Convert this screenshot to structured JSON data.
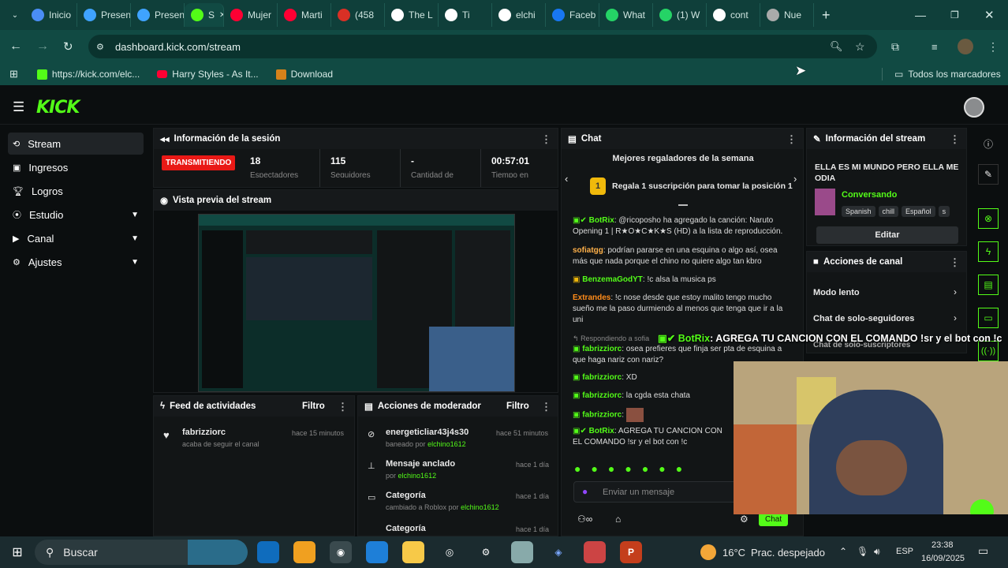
{
  "browser": {
    "tabs": [
      {
        "label": "Inicio",
        "icon": "chrome-icon",
        "color": "#4a8df5"
      },
      {
        "label": "Presen",
        "icon": "slides-icon",
        "color": "#3fa3ff"
      },
      {
        "label": "Presen",
        "icon": "slides-icon",
        "color": "#3fa3ff"
      },
      {
        "label": "S",
        "icon": "kick-icon",
        "color": "#53fc18"
      },
      {
        "label": "Mujer",
        "icon": "youtube-icon",
        "color": "#ff0033"
      },
      {
        "label": "Marti",
        "icon": "youtube-icon",
        "color": "#ff0033"
      },
      {
        "label": "(458",
        "icon": "mail-icon",
        "color": "#d93025"
      },
      {
        "label": "The L",
        "icon": "tiktok-icon",
        "color": "#ffffff"
      },
      {
        "label": "Ti",
        "icon": "tiktok-icon",
        "color": "#ffffff"
      },
      {
        "label": "elchi",
        "icon": "tiktok-icon",
        "color": "#ffffff"
      },
      {
        "label": "Faceb",
        "icon": "facebook-icon",
        "color": "#1877f2"
      },
      {
        "label": "What",
        "icon": "whatsapp-icon",
        "color": "#25d366"
      },
      {
        "label": "(1) W",
        "icon": "whatsapp-icon",
        "color": "#25d366"
      },
      {
        "label": "cont",
        "icon": "google-icon",
        "color": "#ffffff"
      },
      {
        "label": "Nue",
        "icon": "chrome-icon",
        "color": "#aaaaaa"
      }
    ],
    "url": "dashboard.kick.com/stream",
    "bookmarks": [
      "https://kick.com/elc...",
      "Harry Styles - As It...",
      "Download"
    ],
    "all_bookmarks": "Todos los marcadores"
  },
  "sidebar": {
    "items": [
      {
        "label": "Stream",
        "icon": "stream-icon"
      },
      {
        "label": "Ingresos",
        "icon": "money-icon"
      },
      {
        "label": "Logros",
        "icon": "trophy-icon"
      },
      {
        "label": "Estudio",
        "icon": "studio-icon"
      },
      {
        "label": "Canal",
        "icon": "channel-icon"
      },
      {
        "label": "Ajustes",
        "icon": "gear-icon"
      }
    ]
  },
  "session": {
    "title": "Información de la sesión",
    "live": "TRANSMITIENDO",
    "stats": [
      {
        "value": "18",
        "label": "Espectadores"
      },
      {
        "value": "115",
        "label": "Seguidores"
      },
      {
        "value": "-",
        "label": "Cantidad de"
      },
      {
        "value": "00:57:01",
        "label": "Tiempo en"
      }
    ]
  },
  "preview": {
    "title": "Vista previa del stream"
  },
  "feed": {
    "title": "Feed de actividades",
    "filter": "Filtro",
    "items": [
      {
        "user": "fabrizziorc",
        "action": "acaba de seguir el canal",
        "time": "hace 15 minutos"
      }
    ]
  },
  "mod": {
    "title": "Acciones de moderador",
    "filter": "Filtro",
    "items": [
      {
        "title": "energeticliar43j4s30",
        "sub": "baneado por",
        "by": "elchino1612",
        "time": "hace 51 minutos"
      },
      {
        "title": "Mensaje anclado",
        "sub": "por",
        "by": "elchino1612",
        "time": "hace 1 día"
      },
      {
        "title": "Categoría",
        "sub": "cambiado a Roblox por",
        "by": "elchino1612",
        "time": "hace 1 día"
      },
      {
        "title": "Categoría",
        "sub": "",
        "by": "",
        "time": "hace 1 día"
      }
    ]
  },
  "chat": {
    "title": "Chat",
    "gifters_title": "Mejores regaladores de la semana",
    "gifters_rank": "1",
    "gifters_text": "Regala 1 suscripción para tomar la posición 1",
    "messages": [
      {
        "user": "BotRix",
        "color": "#53fc18",
        "text": ": @ricoposho ha agregado la canción: Naruto Opening 1 | R★O★C★K★S (HD) a la lista de reproducción."
      },
      {
        "user": "sofiatgg",
        "color": "#ffb14a",
        "text": ": podrían pararse en una esquina o algo así, osea más que nada porque el chino no quiere algo tan kbro"
      },
      {
        "user": "BenzemaGodYT",
        "color": "#53fc18",
        "text": ": !c alsa la musica ps"
      },
      {
        "user": "Extrandes",
        "color": "#ff8c1a",
        "text": ": !c nose desde que estoy malito tengo mucho sueño me la paso durmiendo al menos que tenga que ir a la uni"
      },
      {
        "user": "fabrizziorc",
        "color": "#53fc18",
        "text": ": osea prefieres que finja ser pta de esquina a que haga nariz con nariz?"
      },
      {
        "user": "fabrizziorc",
        "color": "#53fc18",
        "text": ": XD"
      },
      {
        "user": "fabrizziorc",
        "color": "#53fc18",
        "text": ": la cgda esta chata"
      },
      {
        "user": "fabrizziorc",
        "color": "#53fc18",
        "text": ":"
      },
      {
        "user": "BotRix",
        "color": "#53fc18",
        "text": ": AGREGA TU CANCION CON EL COMANDO !sr y el bot con !c"
      }
    ],
    "reply_label": "Respondiendo a sofia",
    "placeholder": "Enviar un mensaje",
    "send": "Chat"
  },
  "overlay": {
    "user": "BotRix",
    "text": ": AGREGA TU CANCION CON EL COMANDO !sr y el bot con !c"
  },
  "streaminfo": {
    "title": "Información del stream",
    "stream_title": "ELLA ES MI MUNDO PERO ELLA ME ODIA",
    "category": "Conversando",
    "tags": [
      "Spanish",
      "chill",
      "Español",
      "s"
    ],
    "edit": "Editar"
  },
  "actions": {
    "title": "Acciones de canal",
    "items": [
      "Modo lento",
      "Chat de solo-seguidores",
      "Chat de solo-suscriptores"
    ]
  },
  "taskbar": {
    "search": "Buscar",
    "weather": "16°C",
    "weather_desc": "Prac. despejado",
    "lang": "ESP",
    "time": "23:38",
    "date": "16/09/2025"
  },
  "colors": {
    "kick_green": "#53fc18",
    "live_red": "#e91916"
  }
}
